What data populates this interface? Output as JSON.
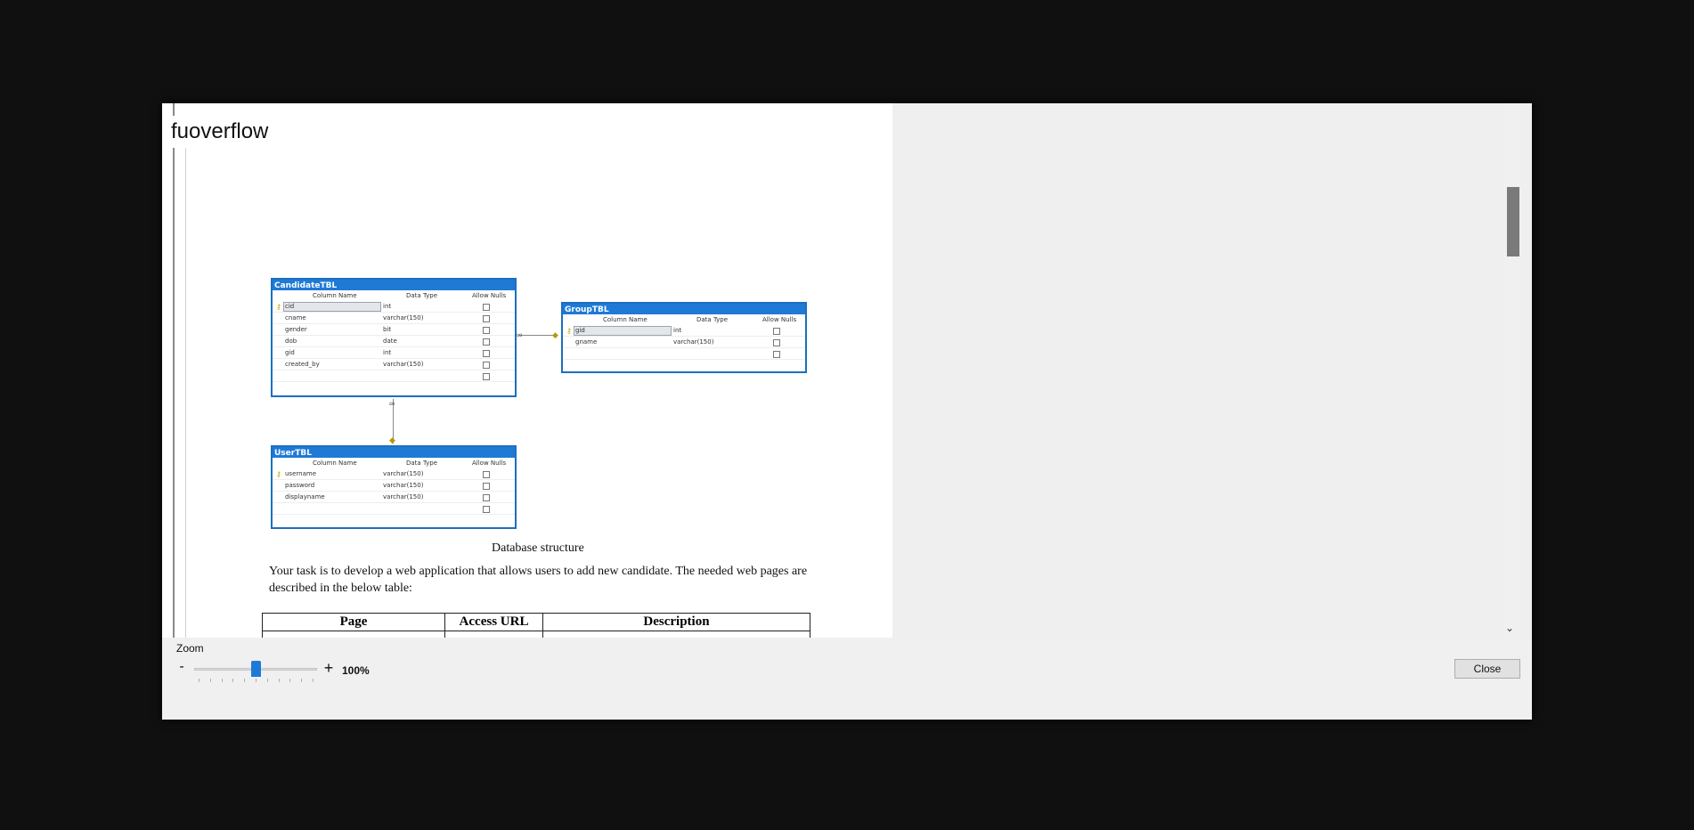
{
  "document": {
    "title": "fuoverflow",
    "caption": "Database structure",
    "paragraph": "Your task is to develop a web application that allows users to add new candidate. The needed web pages are described in the below table:"
  },
  "diagram": {
    "column_header": "Column Name",
    "type_header": "Data Type",
    "null_header": "Allow Nulls",
    "tables": [
      {
        "name": "CandidateTBL",
        "columns": [
          {
            "name": "cid",
            "type": "int",
            "key": true
          },
          {
            "name": "cname",
            "type": "varchar(150)"
          },
          {
            "name": "gender",
            "type": "bit"
          },
          {
            "name": "dob",
            "type": "date"
          },
          {
            "name": "gid",
            "type": "int"
          },
          {
            "name": "created_by",
            "type": "varchar(150)"
          }
        ]
      },
      {
        "name": "GroupTBL",
        "columns": [
          {
            "name": "gid",
            "type": "int",
            "key": true
          },
          {
            "name": "gname",
            "type": "varchar(150)"
          }
        ]
      },
      {
        "name": "UserTBL",
        "columns": [
          {
            "name": "username",
            "type": "varchar(150)",
            "key": true
          },
          {
            "name": "password",
            "type": "varchar(150)"
          },
          {
            "name": "displayname",
            "type": "varchar(150)"
          }
        ]
      }
    ]
  },
  "requirements_table": {
    "headers": [
      "Page",
      "Access URL",
      "Description"
    ]
  },
  "controls": {
    "zoom_label": "Zoom",
    "zoom_minus": "-",
    "zoom_plus": "+",
    "zoom_value": "100%",
    "zoom_level_fraction": 0.5,
    "close_label": "Close"
  },
  "colors": {
    "accent": "#1f7ad6",
    "key_icon": "#c8a500"
  },
  "icons": {
    "key": "key-icon",
    "scroll_down": "chevron-down-icon"
  }
}
